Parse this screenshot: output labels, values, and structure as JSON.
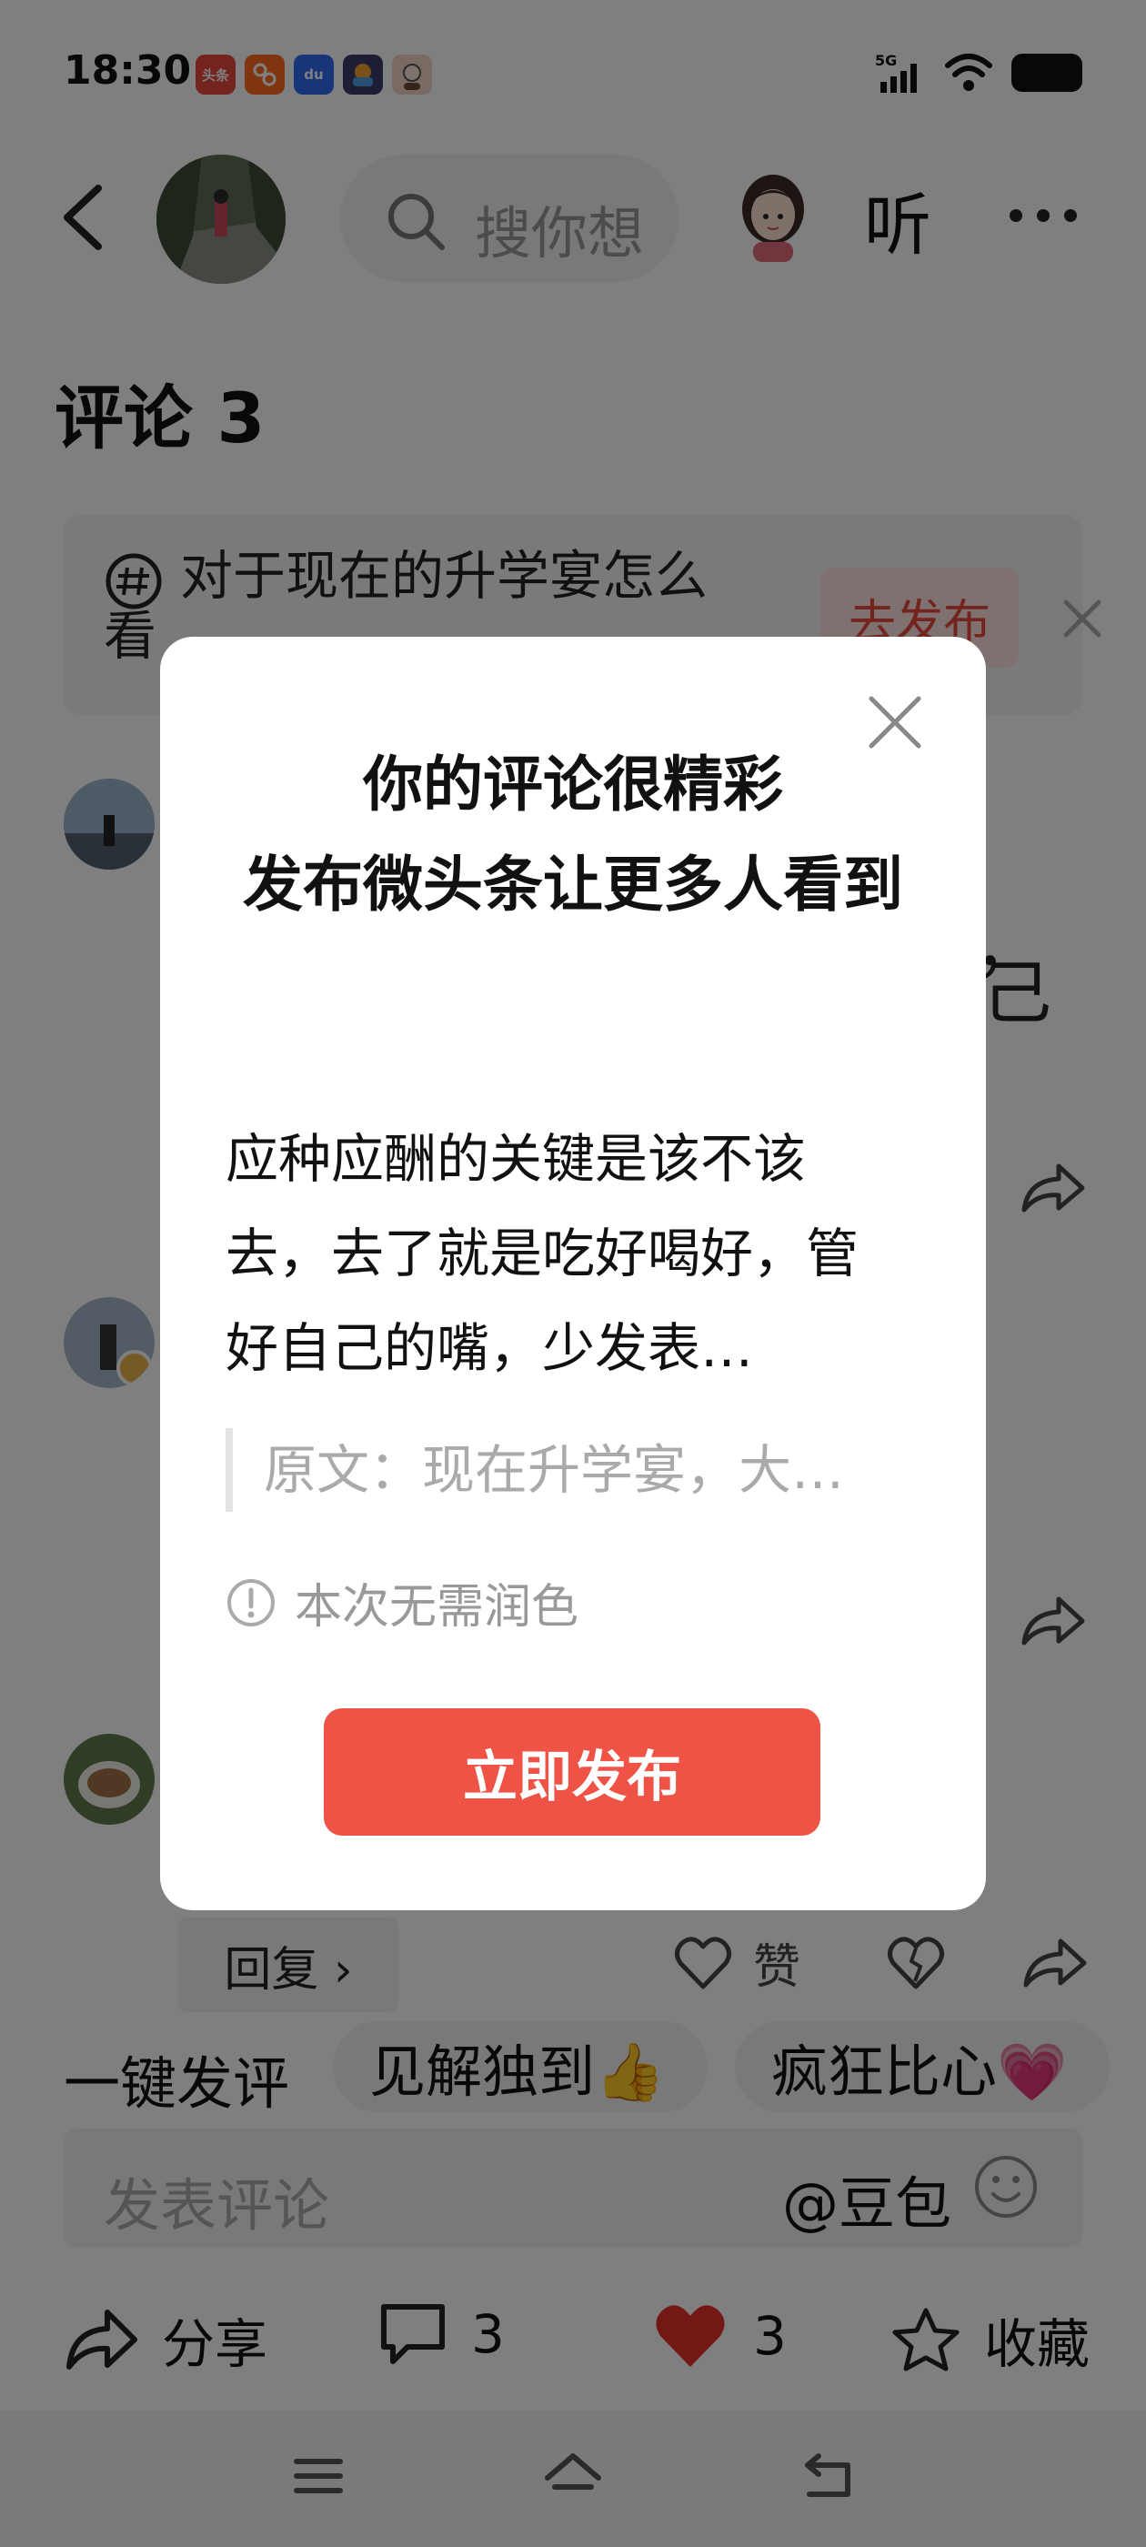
{
  "status_bar": {
    "time": "18:30",
    "app_icons": [
      {
        "name": "toutiao-app-icon",
        "label": "头条",
        "color": "#e8483d"
      },
      {
        "name": "kuaishou-app-icon",
        "label": "",
        "color": "#ff6a1a"
      },
      {
        "name": "baidu-app-icon",
        "label": "du",
        "color": "#2f6bf0"
      },
      {
        "name": "game-app-icon",
        "label": "",
        "color": "#3a3a6a"
      },
      {
        "name": "avatar-app-icon",
        "label": "",
        "color": "#f2d4c6"
      }
    ],
    "network": "5G"
  },
  "header": {
    "search_placeholder": "搜你想",
    "listen_label": "听"
  },
  "comments": {
    "title": "评论 3",
    "topic_card": {
      "text": "对于现在的升学宴怎么看",
      "publish_label": "去发布"
    },
    "partial_text_1": "，",
    "partial_text_2": "己"
  },
  "reply_row": {
    "reply_label": "回复 ›",
    "like_label": "赞"
  },
  "quick_comment": {
    "label": "一键发评",
    "chips": [
      "见解独到👍",
      "疯狂比心💗"
    ]
  },
  "comment_input": {
    "placeholder": "发表评论",
    "mention": "@豆包"
  },
  "bottom_bar": {
    "share_label": "分享",
    "comment_count": "3",
    "like_count": "3",
    "favorite_label": "收藏"
  },
  "dialog": {
    "title": "你的评论很精彩\n发布微头条让更多人看到",
    "body": "应种应酬的关键是该不该去，去了就是吃好喝好，管好自己的嘴，少发表…",
    "original": "原文：现在升学宴，大…",
    "note": "本次无需润色",
    "cta_label": "立即发布"
  },
  "colors": {
    "accent": "#ee5346",
    "like_red": "#e8302a",
    "overlay": "rgba(0,0,0,0.5)"
  }
}
